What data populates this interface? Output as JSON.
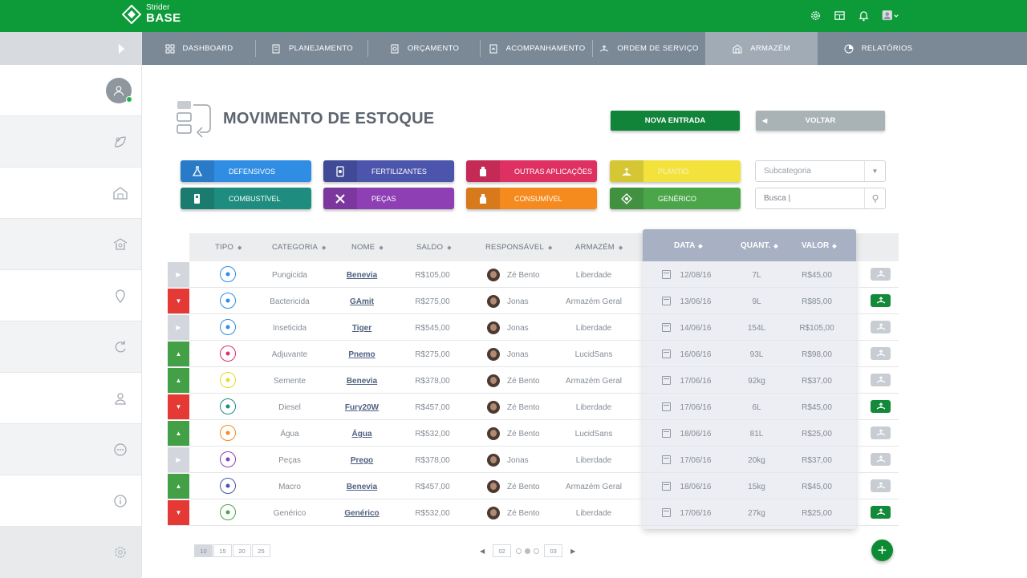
{
  "app": {
    "brand_small": "Strider",
    "brand_big": "BASE"
  },
  "header_icons": [
    "gear-icon",
    "calculator-icon",
    "bell-icon",
    "user-menu-icon"
  ],
  "nav": [
    {
      "label": "DASHBOARD",
      "icon": "dashboard-icon",
      "active": false
    },
    {
      "label": "PLANEJAMENTO",
      "icon": "planning-icon",
      "active": false
    },
    {
      "label": "ORÇAMENTO",
      "icon": "budget-icon",
      "active": false
    },
    {
      "label": "ACOMPANHAMENTO",
      "icon": "tracking-icon",
      "active": false
    },
    {
      "label": "ORDEM DE SERVIÇO",
      "icon": "service-order-icon",
      "active": false
    },
    {
      "label": "ARMAZÉM",
      "icon": "warehouse-icon",
      "active": true
    },
    {
      "label": "RELATÓRIOS",
      "icon": "reports-icon",
      "active": false
    }
  ],
  "sidebar": [
    "user-avatar",
    "leaf-icon",
    "barn-icon",
    "silo-icon",
    "map-pin-icon",
    "refresh-icon",
    "person-icon",
    "more-icon",
    "info-icon",
    "gear-icon"
  ],
  "page": {
    "title": "MOVIMENTO DE ESTOQUE",
    "new_entry_label": "NOVA ENTRADA",
    "back_label": "VOLTAR"
  },
  "categories": [
    {
      "label": "DEFENSIVOS",
      "color": "#2f8de4",
      "icon": "flask-icon"
    },
    {
      "label": "FERTILIZANTES",
      "color": "#4b55ab",
      "icon": "fertilizer-icon"
    },
    {
      "label": "OUTRAS APLICAÇÕES",
      "color": "#df3062",
      "icon": "bottle-icon"
    },
    {
      "label": "PLANTIO",
      "color": "#f3e23b",
      "icon": "seed-icon"
    },
    {
      "label": "COMBUSTÍVEL",
      "color": "#1e8c7e",
      "icon": "fuel-icon"
    },
    {
      "label": "PEÇAS",
      "color": "#8e3fb4",
      "icon": "tools-icon"
    },
    {
      "label": "CONSUMÍVEL",
      "color": "#f58b1f",
      "icon": "consumable-icon"
    },
    {
      "label": "GENÉRICO",
      "color": "#4ba649",
      "icon": "generic-icon"
    }
  ],
  "filters": {
    "subcategory_placeholder": "Subcategoria",
    "search_placeholder": "Busca |"
  },
  "columns": {
    "tipo": "TIPO",
    "categoria": "CATEGORIA",
    "nome": "NOME",
    "saldo": "SALDO",
    "responsavel": "RESPONSÁVEL",
    "armazem": "ARMAZÉM",
    "data": "DATA",
    "quant": "QUANT.",
    "valor": "VALOR"
  },
  "rows": [
    {
      "dir": "none",
      "type_color": "#2f8de4",
      "categoria": "Pungicida",
      "nome": "Benevia",
      "saldo": "R$105,00",
      "resp": "Zé Bento",
      "armazem": "Liberdade",
      "data": "12/08/16",
      "quant": "7L",
      "valor": "R$45,00",
      "active": false
    },
    {
      "dir": "down",
      "type_color": "#2f8de4",
      "categoria": "Bactericida",
      "nome": "GAmit",
      "saldo": "R$275,00",
      "resp": "Jonas",
      "armazem": "Armazém Geral",
      "data": "13/06/16",
      "quant": "9L",
      "valor": "R$85,00",
      "active": true
    },
    {
      "dir": "none",
      "type_color": "#2f8de4",
      "categoria": "Inseticida",
      "nome": "Tiger",
      "saldo": "R$545,00",
      "resp": "Jonas",
      "armazem": "Liberdade",
      "data": "14/06/16",
      "quant": "154L",
      "valor": "R$105,00",
      "active": false
    },
    {
      "dir": "up",
      "type_color": "#df3062",
      "categoria": "Adjuvante",
      "nome": "Pnemo",
      "saldo": "R$275,00",
      "resp": "Jonas",
      "armazem": "LucidSans",
      "data": "16/06/16",
      "quant": "93L",
      "valor": "R$98,00",
      "active": false
    },
    {
      "dir": "up",
      "type_color": "#e8d92c",
      "categoria": "Semente",
      "nome": "Benevia",
      "saldo": "R$378,00",
      "resp": "Zé Bento",
      "armazem": "Armazém Geral",
      "data": "17/06/16",
      "quant": "92kg",
      "valor": "R$37,00",
      "active": false
    },
    {
      "dir": "down",
      "type_color": "#1e8c7e",
      "categoria": "Diesel",
      "nome": "Fury20W",
      "saldo": "R$457,00",
      "resp": "Zé Bento",
      "armazem": "Liberdade",
      "data": "17/06/16",
      "quant": "6L",
      "valor": "R$45,00",
      "active": true
    },
    {
      "dir": "up",
      "type_color": "#f58b1f",
      "categoria": "Água",
      "nome": "Água",
      "saldo": "R$532,00",
      "resp": "Zé Bento",
      "armazem": "LucidSans",
      "data": "18/06/16",
      "quant": "81L",
      "valor": "R$25,00",
      "active": false
    },
    {
      "dir": "none",
      "type_color": "#8e3fb4",
      "categoria": "Peças",
      "nome": "Prego",
      "saldo": "R$378,00",
      "resp": "Jonas",
      "armazem": "Liberdade",
      "data": "17/06/16",
      "quant": "20kg",
      "valor": "R$37,00",
      "active": false
    },
    {
      "dir": "up",
      "type_color": "#4b55ab",
      "categoria": "Macro",
      "nome": "Benevia",
      "saldo": "R$457,00",
      "resp": "Zé Bento",
      "armazem": "Armazém Geral",
      "data": "18/06/16",
      "quant": "15kg",
      "valor": "R$45,00",
      "active": false
    },
    {
      "dir": "down",
      "type_color": "#4ba649",
      "categoria": "Genérico",
      "nome": "Genérico",
      "saldo": "R$532,00",
      "resp": "Zé Bento",
      "armazem": "Liberdade",
      "data": "17/06/16",
      "quant": "27kg",
      "valor": "R$25,00",
      "active": true
    }
  ],
  "pagination": {
    "page_sizes": [
      "10",
      "15",
      "20",
      "25"
    ],
    "selected_size": "10",
    "prev_page": "02",
    "next_page": "03",
    "dots": 3,
    "current_dot": 2
  },
  "fab_label": "+"
}
